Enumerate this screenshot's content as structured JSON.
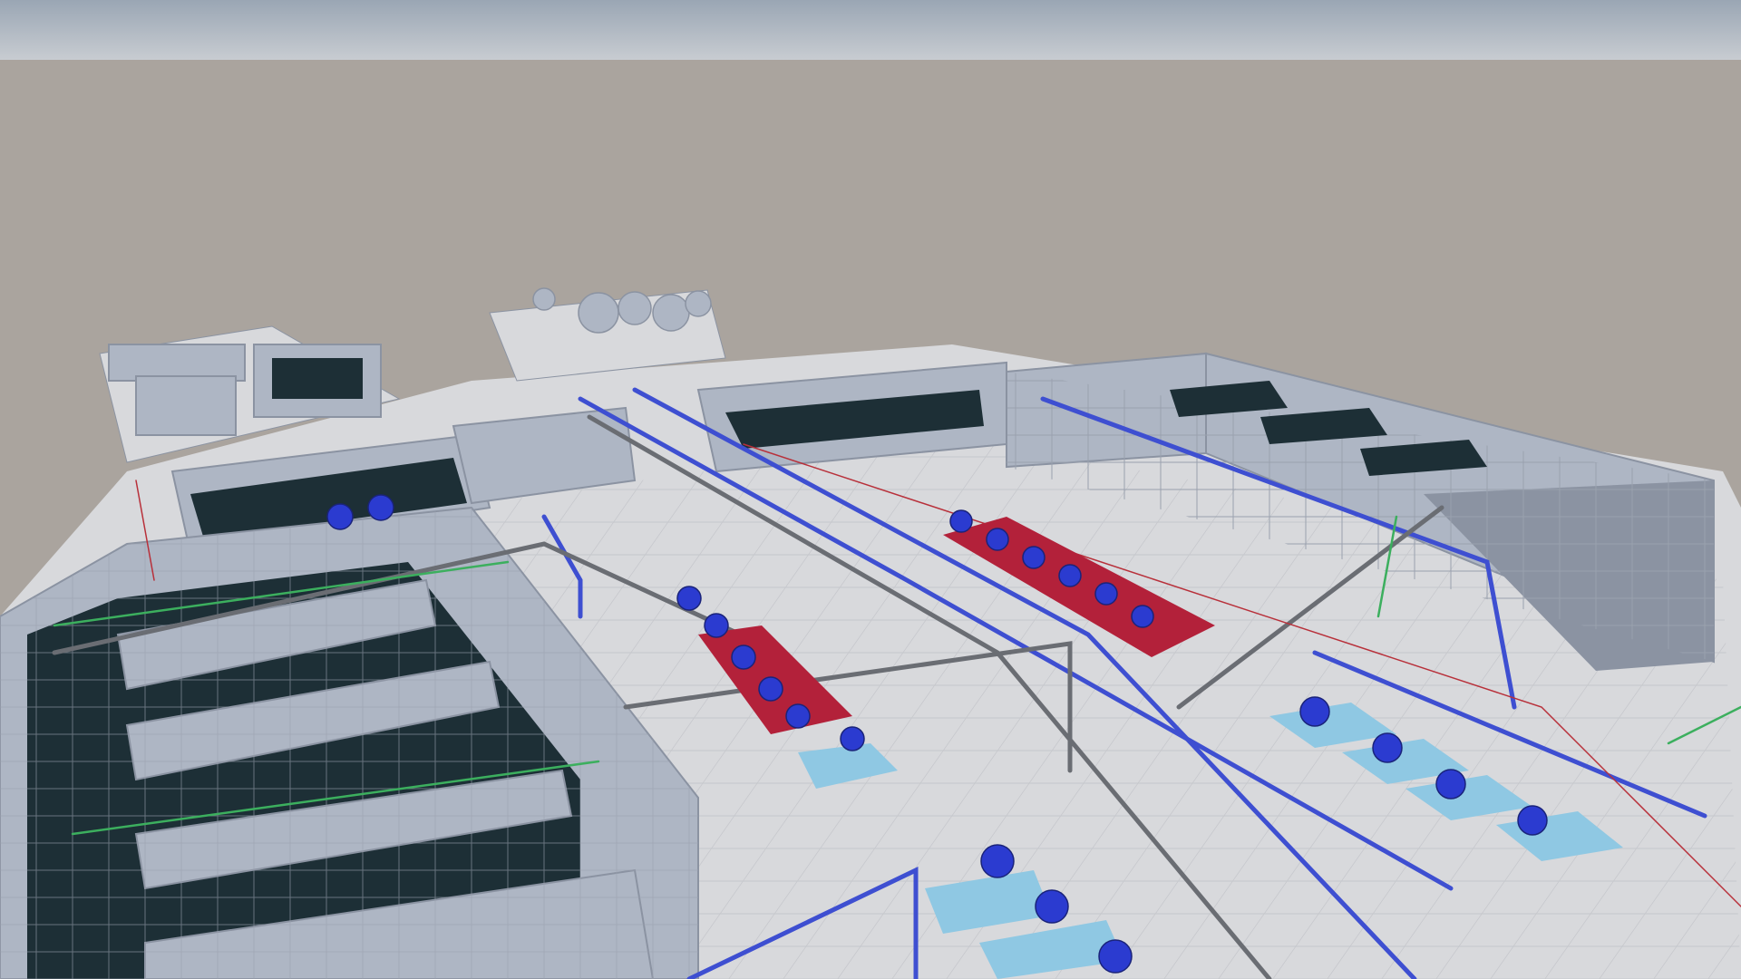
{
  "scene": {
    "colors": {
      "sky_top": "#9aa6b4",
      "sky_bottom": "#c9cdd2",
      "ground": "#aaa49e",
      "plant_floor": "#d8d9dc",
      "tank_wall": "#aeb6c4",
      "tank_wall_dark": "#8b93a2",
      "water": "#1d2f36",
      "pipe_blue": "#3e4fd1",
      "pipe_gray": "#6a6d73",
      "pipe_green": "#3caf5e",
      "pipe_red": "#b8303a",
      "pump_pad_red": "#b3213a",
      "pump_pad_cyan": "#8fc8e3",
      "motor_blue": "#2b3bd0"
    }
  }
}
